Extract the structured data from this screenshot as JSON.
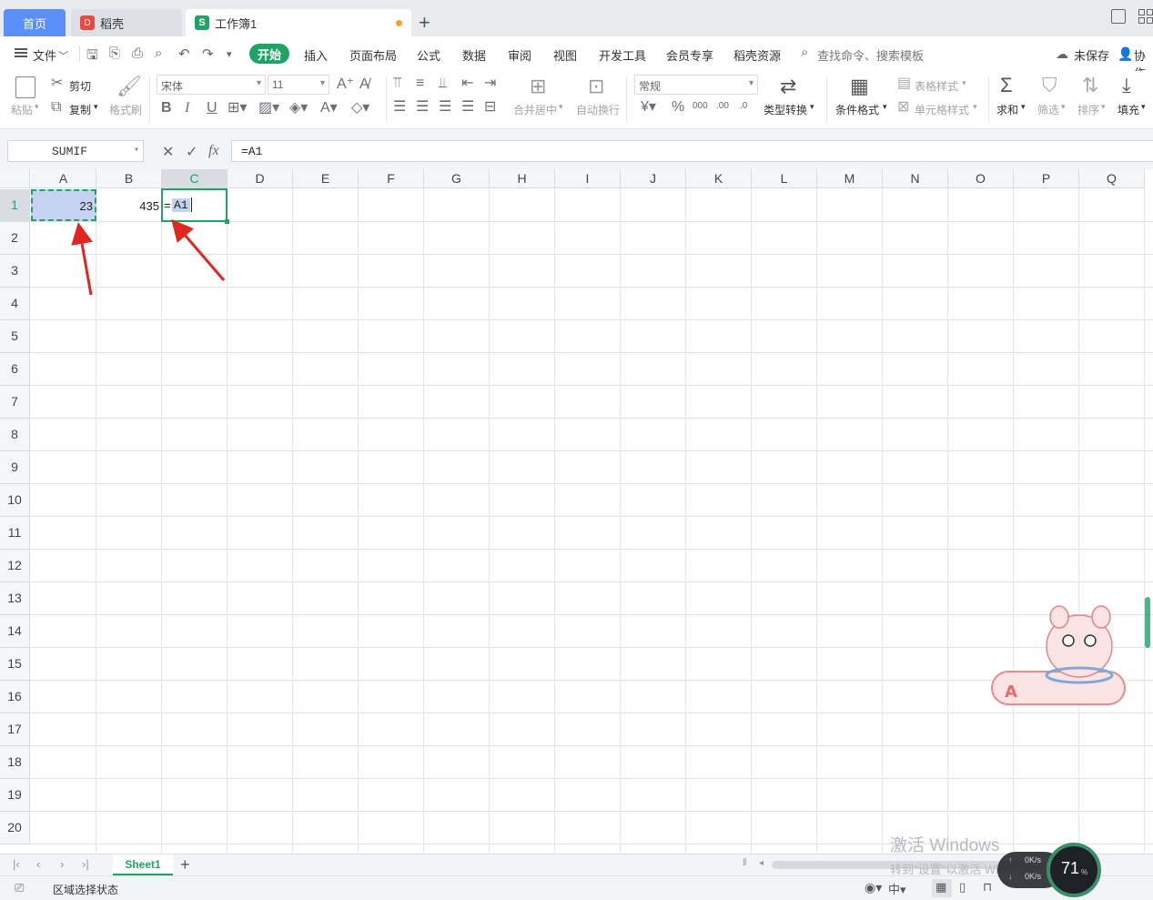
{
  "tabs": {
    "home": "首页",
    "daoke": "稻壳",
    "workbook": "工作簿1",
    "daoke_logo": "D",
    "workbook_logo": "S"
  },
  "menu": {
    "file": "文件",
    "start": "开始",
    "items": [
      "插入",
      "页面布局",
      "公式",
      "数据",
      "审阅",
      "视图",
      "开发工具",
      "会员专享",
      "稻壳资源"
    ],
    "search": "查找命令、搜索模板",
    "unsaved": "未保存",
    "collab": "协作"
  },
  "ribbon": {
    "paste": "粘贴",
    "cut": "剪切",
    "copy": "复制",
    "format_painter": "格式刷",
    "font_name": "宋体",
    "font_size": "11",
    "merge_center": "合并居中",
    "wrap_text": "自动换行",
    "number_format": "常规",
    "type_convert": "类型转换",
    "cond_format": "条件格式",
    "table_style": "表格样式",
    "cell_style": "单元格样式",
    "sum": "求和",
    "filter": "筛选",
    "sort": "排序",
    "fill": "填充",
    "dec_inc": ".00",
    "dec_dec": ".0",
    "thousands": "000"
  },
  "formula_bar": {
    "name_box": "SUMIF",
    "formula": "=A1",
    "fx": "fx"
  },
  "columns": [
    "A",
    "B",
    "C",
    "D",
    "E",
    "F",
    "G",
    "H",
    "I",
    "J",
    "K",
    "L",
    "M",
    "N",
    "O",
    "P",
    "Q"
  ],
  "rows": [
    "1",
    "2",
    "3",
    "4",
    "5",
    "6",
    "7",
    "8",
    "9",
    "10",
    "11",
    "12",
    "13",
    "14",
    "15",
    "16",
    "17",
    "18",
    "19",
    "20"
  ],
  "cells": {
    "A1": "23",
    "B1": "435",
    "C1_eq": "=",
    "C1_ref": "A1"
  },
  "sheet": {
    "name": "Sheet1"
  },
  "status": {
    "mode": "区域选择状态"
  },
  "watermark": {
    "line1": "激活 Windows",
    "line2": "转到\"设置\"以激活 Windows。"
  },
  "speed_widget": {
    "percent": "71",
    "up": "0K/s",
    "down": "0K/s"
  },
  "colors": {
    "accent_green": "#21a366",
    "tab_blue": "#5b8ff9",
    "selection_fill": "#c5d2f2",
    "arrow_red": "#e0261f"
  }
}
